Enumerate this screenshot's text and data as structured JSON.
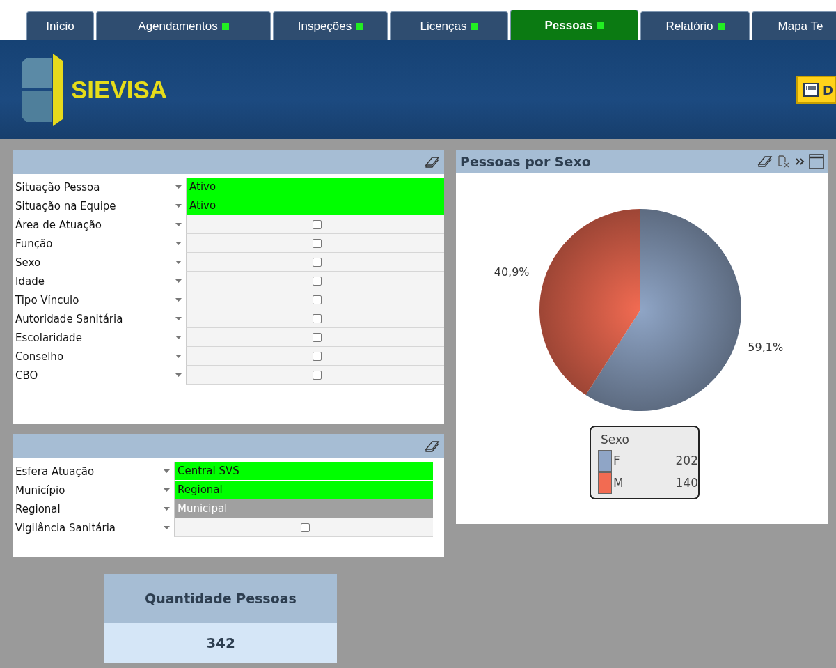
{
  "tabs": [
    {
      "label": "Início",
      "selected": false,
      "indicator": false
    },
    {
      "label": "Agendamentos",
      "selected": false,
      "indicator": true
    },
    {
      "label": "Inspeções",
      "selected": false,
      "indicator": true
    },
    {
      "label": "Licenças",
      "selected": false,
      "indicator": true
    },
    {
      "label": "Pessoas",
      "selected": true,
      "indicator": true
    },
    {
      "label": "Relatório",
      "selected": false,
      "indicator": true
    },
    {
      "label": "Mapa Te",
      "selected": false,
      "indicator": false
    }
  ],
  "header": {
    "app_name": "SIEVISA",
    "button_label": "D"
  },
  "filter_panel": {
    "rows": [
      {
        "label": "Situação Pessoa",
        "selected": true,
        "excluded": false,
        "value": "Ativo"
      },
      {
        "label": "Situação na Equipe",
        "selected": true,
        "excluded": false,
        "value": "Ativo"
      },
      {
        "label": "Área de Atuação",
        "selected": false,
        "excluded": false
      },
      {
        "label": "Função",
        "selected": false,
        "excluded": false
      },
      {
        "label": "Sexo",
        "selected": false,
        "excluded": false
      },
      {
        "label": "Idade",
        "selected": false,
        "excluded": false
      },
      {
        "label": "Tipo Vínculo",
        "selected": false,
        "excluded": false
      },
      {
        "label": "Autoridade Sanitária",
        "selected": false,
        "excluded": false
      },
      {
        "label": "Escolaridade",
        "selected": false,
        "excluded": false
      },
      {
        "label": "Conselho",
        "selected": false,
        "excluded": false
      },
      {
        "label": "CBO",
        "selected": false,
        "excluded": false
      }
    ]
  },
  "scope_panel": {
    "rows": [
      {
        "label": "Esfera Atuação",
        "selected": true,
        "excluded": false,
        "value": "Central SVS"
      },
      {
        "label": "Município",
        "selected": true,
        "excluded": false,
        "value": "Regional"
      },
      {
        "label": "Regional",
        "selected": false,
        "excluded": true,
        "value": "Municipal"
      },
      {
        "label": "Vigilância Sanitária",
        "selected": false,
        "excluded": false
      }
    ]
  },
  "kpi": {
    "title": "Quantidade Pessoas",
    "value": "342"
  },
  "chart_panel": {
    "title": "Pessoas por Sexo",
    "legend_title": "Sexo",
    "legend": [
      {
        "value": "202",
        "color": "#8fa5c6"
      },
      {
        "value": "140",
        "color": "#f26b52"
      }
    ],
    "chart_data": {
      "type": "pie",
      "categories": [
        "F",
        "M"
      ],
      "values": [
        59.1,
        40.9
      ],
      "data_labels": true,
      "value_labels": [
        "59,1%",
        "40,9%"
      ]
    }
  }
}
